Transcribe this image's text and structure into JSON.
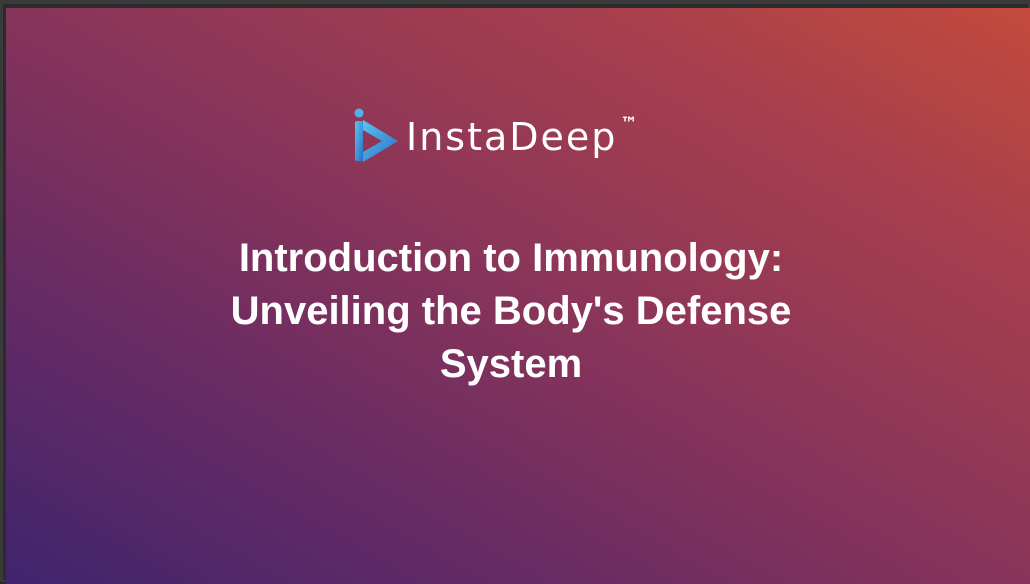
{
  "slide": {
    "logo": {
      "brand": "InstaDeep",
      "trademark": "™",
      "mark_icon": "instadeep-play-i-icon",
      "colors": {
        "mark_light": "#4fb3e8",
        "mark_dark": "#2a6fc4"
      }
    },
    "title": {
      "lines": [
        "Introduction to Immunology: ",
        "Unveiling the Body's Defense",
        "System"
      ]
    },
    "colors": {
      "gradient_start": "#40246e",
      "gradient_end": "#c44a3c",
      "text": "#ffffff"
    }
  }
}
